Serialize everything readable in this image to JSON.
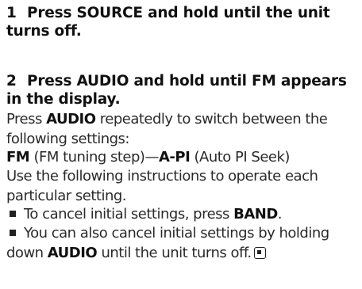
{
  "steps": [
    {
      "number": "1",
      "instruction": "Press SOURCE and hold until the unit turns off."
    },
    {
      "number": "2",
      "instruction": "Press AUDIO and hold until FM appears in the display."
    }
  ],
  "paragraphs": {
    "repeat": {
      "pre": "Press ",
      "key": "AUDIO",
      "post": " repeatedly to switch between the following settings:"
    },
    "settings": {
      "fm_key": "FM",
      "fm_desc": " (FM tuning step)—",
      "api_key": "A-PI",
      "api_desc": " (Auto PI Seek)"
    },
    "instructions": "Use the following instructions to operate each particular setting."
  },
  "bullets": [
    {
      "pre": "To cancel initial settings, press ",
      "key": "BAND",
      "post": "."
    },
    {
      "pre": "You can also cancel initial settings by holding down ",
      "key": "AUDIO",
      "post": " until the unit turns off."
    }
  ],
  "icons": {
    "bullet": "square-bullet-icon",
    "end_mark": "end-of-section-icon"
  }
}
